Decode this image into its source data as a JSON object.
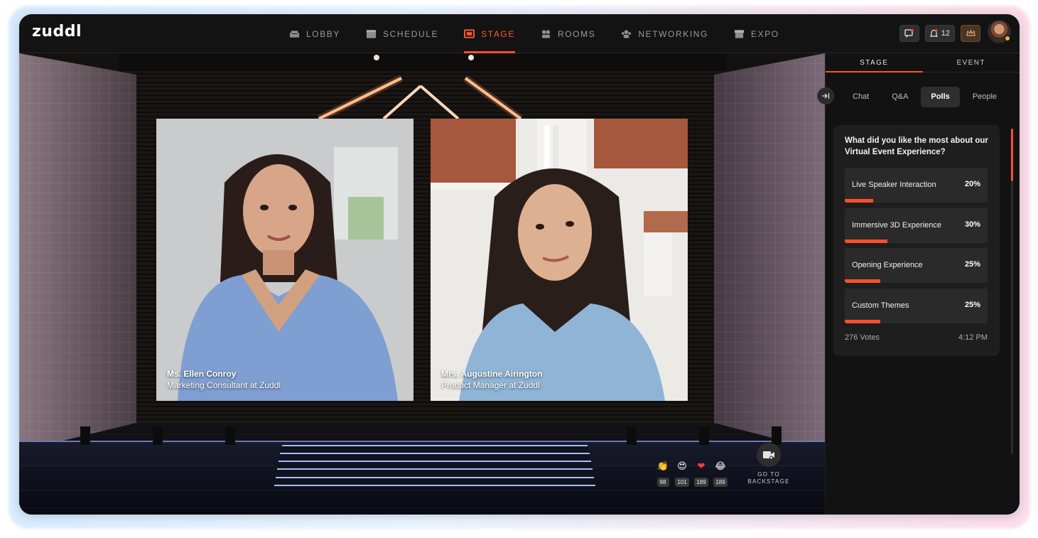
{
  "app": {
    "logo": "zuddl"
  },
  "nav": [
    {
      "label": "LOBBY",
      "icon": "sofa-icon",
      "active": false
    },
    {
      "label": "SCHEDULE",
      "icon": "calendar-icon",
      "active": false
    },
    {
      "label": "STAGE",
      "icon": "stage-icon",
      "active": true
    },
    {
      "label": "ROOMS",
      "icon": "rooms-icon",
      "active": false
    },
    {
      "label": "NETWORKING",
      "icon": "networking-icon",
      "active": false
    },
    {
      "label": "EXPO",
      "icon": "booth-icon",
      "active": false
    }
  ],
  "topright": {
    "notifications_count": "12"
  },
  "colors": {
    "accent": "#ff4f2a",
    "panel_bg": "#121212",
    "card_bg": "#1e1e1e"
  },
  "stage": {
    "speakers": [
      {
        "name": "Ms. Ellen Conroy",
        "title": "Marketing Consultant at Zuddl"
      },
      {
        "name": "Mrs. Augustine Airington",
        "title": "Product Manager at Zuddl"
      }
    ],
    "reactions": [
      {
        "emoji": "👏",
        "icon": "clap-icon",
        "count": "98"
      },
      {
        "emoji": "😍",
        "icon": "heart-eyes-icon",
        "count": "101"
      },
      {
        "emoji": "❤",
        "icon": "heart-icon",
        "count": "189"
      },
      {
        "emoji": "😂",
        "icon": "laughing-icon",
        "count": "189"
      }
    ],
    "backstage": {
      "line1": "GO TO",
      "line2": "BACKSTAGE"
    }
  },
  "panel": {
    "tabs": [
      {
        "label": "STAGE",
        "active": true
      },
      {
        "label": "EVENT",
        "active": false
      }
    ],
    "subtabs": [
      {
        "label": "Chat",
        "active": false
      },
      {
        "label": "Q&A",
        "active": false
      },
      {
        "label": "Polls",
        "active": true
      },
      {
        "label": "People",
        "active": false
      }
    ],
    "poll": {
      "question": "What did you like the most about our Virtual Event Experience?",
      "options": [
        {
          "label": "Live Speaker Interaction",
          "percent": "20%",
          "value": 0.2
        },
        {
          "label": "Immersive 3D Experience",
          "percent": "30%",
          "value": 0.3
        },
        {
          "label": "Opening Experience",
          "percent": "25%",
          "value": 0.25
        },
        {
          "label": "Custom Themes",
          "percent": "25%",
          "value": 0.25
        }
      ],
      "votes": "276 Votes",
      "time": "4:12 PM"
    }
  }
}
